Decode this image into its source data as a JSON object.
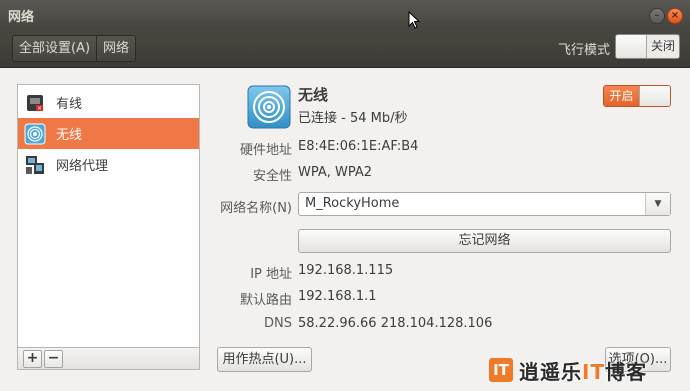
{
  "window": {
    "title": "网络"
  },
  "toolbar": {
    "breadcrumb": [
      "全部设置(A)",
      "网络"
    ],
    "airplane_mode_label": "飞行模式",
    "airplane_mode_state": "关闭"
  },
  "sidebar": {
    "items": [
      {
        "label": "有线",
        "icon": "wired-icon",
        "selected": false
      },
      {
        "label": "无线",
        "icon": "wireless-icon",
        "selected": true
      },
      {
        "label": "网络代理",
        "icon": "proxy-icon",
        "selected": false
      }
    ],
    "add_label": "+",
    "remove_label": "−"
  },
  "detail": {
    "title": "无线",
    "status": "已连接 - 54 Mb/秒",
    "power_state": "开启",
    "hardware_address_label": "硬件地址",
    "hardware_address": "E8:4E:06:1E:AF:B4",
    "security_label": "安全性",
    "security": "WPA, WPA2",
    "network_name_label": "网络名称(N)",
    "network_name": "M_RockyHome",
    "forget_label": "忘记网络",
    "ip_label": "IP 地址",
    "ip": "192.168.1.115",
    "gateway_label": "默认路由",
    "gateway": "192.168.1.1",
    "dns_label": "DNS",
    "dns": "58.22.96.66 218.104.128.106",
    "hotspot_label": "用作热点(U)...",
    "options_label": "选项(O)..."
  },
  "watermark": {
    "logo": "IT",
    "text_a": "逍遥乐",
    "text_hl": "IT",
    "text_b": "博客"
  },
  "colors": {
    "accent": "#f07746",
    "titlebar": "#45443f"
  }
}
